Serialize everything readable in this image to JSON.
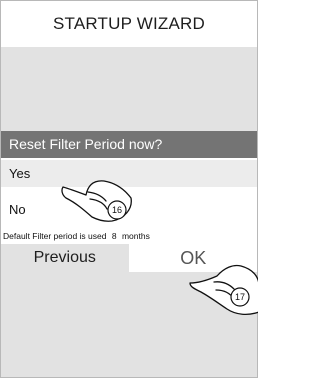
{
  "header": {
    "title": "STARTUP WIZARD"
  },
  "question": {
    "text": "Reset Filter Period now?"
  },
  "options": [
    {
      "label": "Yes"
    },
    {
      "label": "No"
    }
  ],
  "default_info": {
    "prefix": "Default Filter period is used",
    "value": "8",
    "unit": "months"
  },
  "nav": {
    "previous_label": "Previous",
    "ok_label": "OK"
  },
  "annotations": [
    {
      "number": "16"
    },
    {
      "number": "17"
    }
  ]
}
